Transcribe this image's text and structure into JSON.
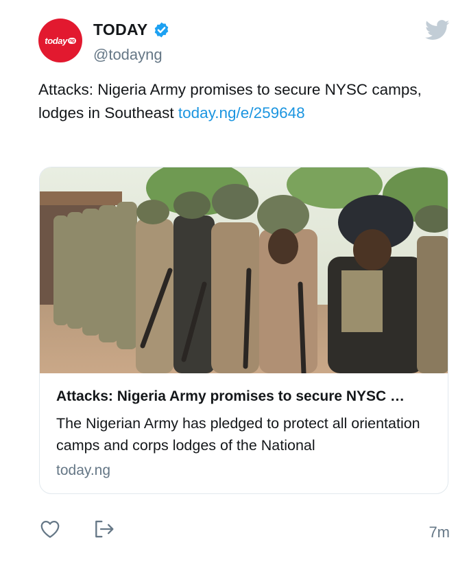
{
  "account": {
    "avatar_text": "today",
    "avatar_badge": "ng",
    "display_name": "TODAY",
    "handle": "@todayng"
  },
  "tweet": {
    "text": "Attacks: Nigeria Army promises to secure NYSC camps, lodges in Southeast ",
    "link": "today.ng/e/259648"
  },
  "card": {
    "title": "Attacks: Nigeria Army promises to secure NYSC …",
    "description": "The Nigerian Army has pledged to protect all orientation camps and corps lodges of the National",
    "domain": "today.ng"
  },
  "timestamp": "7m",
  "colors": {
    "brand_red": "#e2192f",
    "twitter_blue": "#1b95e0",
    "muted": "#657786",
    "border": "#e1e8ed"
  },
  "icons": {
    "verified": "verified-badge-icon",
    "bird": "twitter-bird-icon",
    "like": "heart-icon",
    "share": "share-icon"
  }
}
